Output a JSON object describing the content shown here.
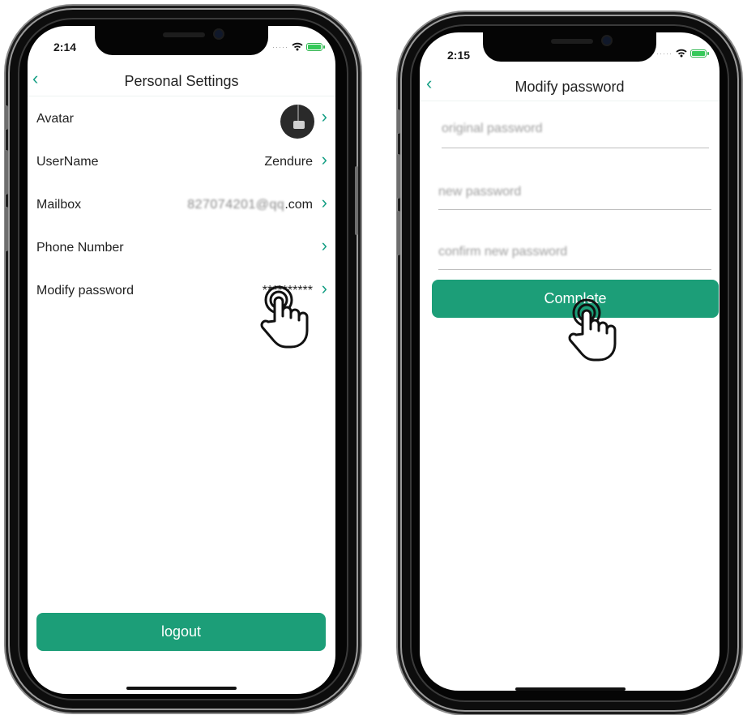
{
  "left_screen": {
    "status": {
      "time": "2:14"
    },
    "title": "Personal Settings",
    "rows": [
      {
        "label": "Avatar",
        "value": ""
      },
      {
        "label": "UserName",
        "value": "Zendure"
      },
      {
        "label": "Mailbox",
        "value_blurred": "827074201@qq",
        "value_suffix": ".com"
      },
      {
        "label": "Phone Number",
        "value": ""
      },
      {
        "label": "Modify password",
        "value": "**********"
      }
    ],
    "logout_label": "logout"
  },
  "right_screen": {
    "status": {
      "time": "2:15"
    },
    "title": "Modify password",
    "fields": {
      "original": "original password",
      "new": "new password",
      "confirm": "confirm new password"
    },
    "complete_label": "Complete"
  },
  "colors": {
    "accent": "#1c9e78",
    "back_arrow": "#17a085"
  },
  "icons": {
    "back": "chevron-left-icon",
    "row_arrow": "chevron-right-icon",
    "tap": "tap-hand-icon"
  }
}
